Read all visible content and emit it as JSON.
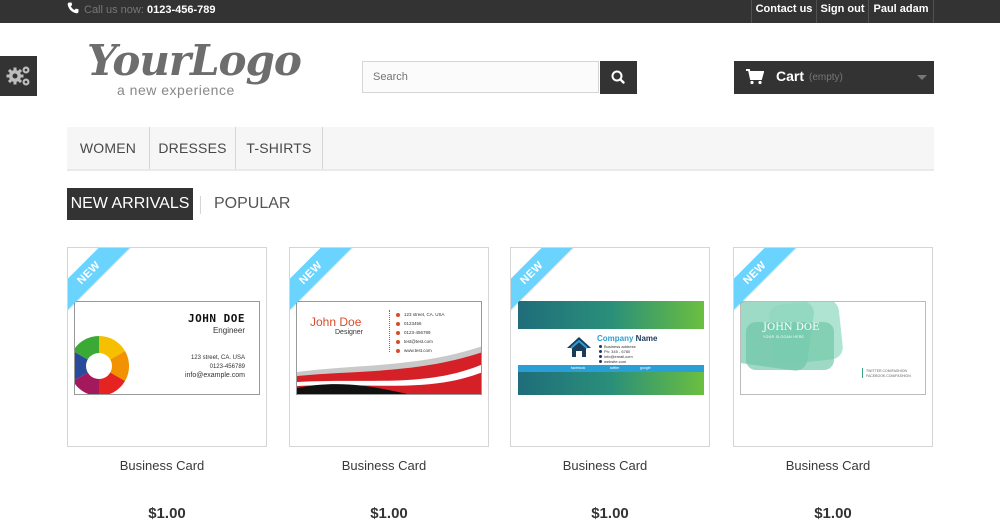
{
  "topbar": {
    "call_label": "Call us now:",
    "phone": "0123-456-789",
    "nav": [
      "Contact us",
      "Sign out",
      "Paul adam"
    ]
  },
  "logo": {
    "script": "YourLogo",
    "tagline": "a new experience"
  },
  "search": {
    "placeholder": "Search"
  },
  "cart": {
    "label": "Cart",
    "status": "(empty)"
  },
  "menu": [
    "WOMEN",
    "DRESSES",
    "T-SHIRTS"
  ],
  "tabs": {
    "active": "NEW ARRIVALS",
    "inactive": "POPULAR"
  },
  "colors": {
    "dark": "#333333",
    "ribbon": "#6ad4ff",
    "menu_bg": "#f6f6f6"
  },
  "products": [
    {
      "badge": "NEW",
      "name": "Business Card",
      "price": "$1.00",
      "card": {
        "name": "JOHN DOE",
        "title": "Engineer",
        "address": "123 street, CA. USA",
        "phone": "0123-456789",
        "email": "info@example.com"
      }
    },
    {
      "badge": "NEW",
      "name": "Business Card",
      "price": "$1.00",
      "card": {
        "name": "John Doe",
        "title": "Designer",
        "lines": [
          "123 street, CA. USA",
          "0123456",
          "0123-456789",
          "test@test.com",
          "www.test.com"
        ]
      }
    },
    {
      "badge": "NEW",
      "name": "Business Card",
      "price": "$1.00",
      "card": {
        "company_a": "Company",
        "company_b": " Name",
        "lines": [
          "Business address",
          "Ph: 345 - 6780",
          "info@email.com",
          "website.com"
        ],
        "footer": [
          "facebook",
          "twitter",
          "google"
        ]
      }
    },
    {
      "badge": "NEW",
      "name": "Business Card",
      "price": "$1.00",
      "card": {
        "name": "JOHN DOE",
        "subtitle": "YOUR SLOGAN HERE",
        "lines": [
          "TWITTER.COM/FASHION",
          "FACEBOOK.COM/FASHION"
        ]
      }
    }
  ]
}
